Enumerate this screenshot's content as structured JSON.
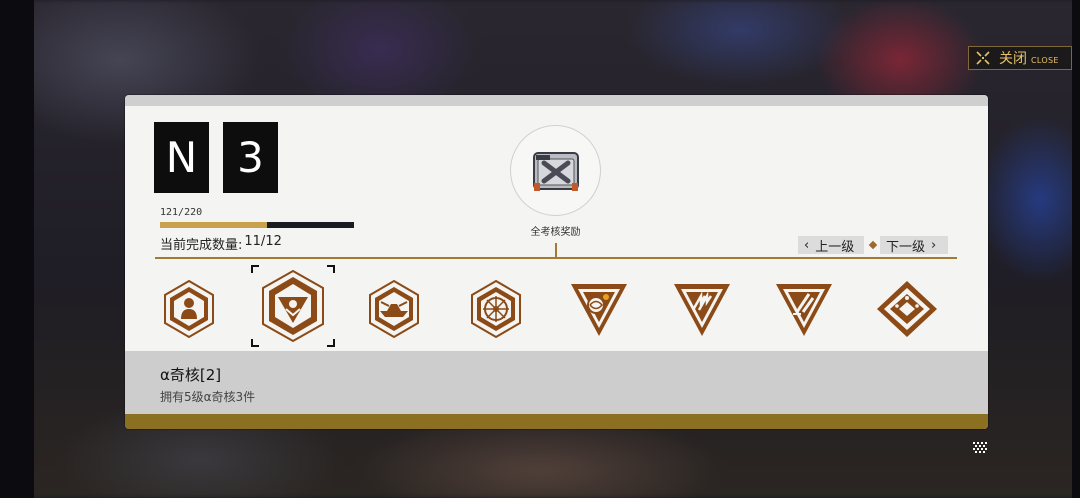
{
  "close": {
    "label_zh": "关闭",
    "label_en": "CLOSE"
  },
  "rank": {
    "letter": "N",
    "level": "3"
  },
  "progress": {
    "text": "121/220",
    "current": 121,
    "max": 220
  },
  "completion": {
    "label": "当前完成数量:",
    "value": "11/12"
  },
  "reward": {
    "icon": "supply-crate-icon",
    "label": "全考核奖励"
  },
  "nav": {
    "prev_label": "上一级",
    "next_label": "下一级"
  },
  "badges": [
    {
      "icon": "person-hexagon-icon",
      "selected": false
    },
    {
      "icon": "eye-triangle-hexagon-icon",
      "selected": true
    },
    {
      "icon": "ship-hexagon-icon",
      "selected": false
    },
    {
      "icon": "compass-hexagon-icon",
      "selected": false
    },
    {
      "icon": "orb-triangle-icon",
      "selected": false
    },
    {
      "icon": "arrows-triangle-icon",
      "selected": false
    },
    {
      "icon": "slash-triangle-icon",
      "selected": false
    },
    {
      "icon": "diamond-icon",
      "selected": false
    }
  ],
  "selected_item": {
    "title": "α奇核[2]",
    "description": "拥有5级α奇核3件"
  },
  "colors": {
    "gold": "#a17a36",
    "bronze": "#8b4a16",
    "panel": "#f4f4f2",
    "bar": "#8c7022"
  }
}
